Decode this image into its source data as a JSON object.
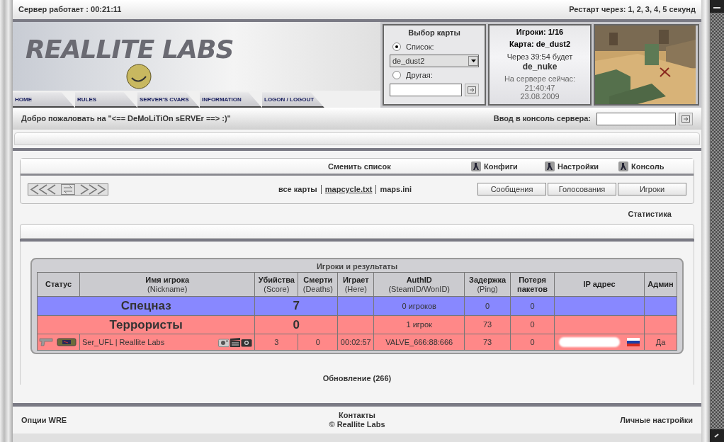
{
  "top_bar": {
    "uptime": "Сервер работает : 00:21:11",
    "restart": "Рестарт через: 1, 2, 3, 4, 5 секунд"
  },
  "logo": "REALLITE LABS",
  "nav": [
    "HOME",
    "RULES",
    "SERVER'S CVARS",
    "INFORMATION",
    "LOGON / LOGOUT"
  ],
  "map_select": {
    "title": "Выбор карты",
    "options": [
      {
        "label": "Список:",
        "selected": true,
        "kind": "select",
        "value": "de_dust2"
      },
      {
        "label": "Другая:",
        "selected": false,
        "kind": "input"
      }
    ]
  },
  "server_info": {
    "players": "Игроки: 1/16",
    "map": "Карта: de_dust2",
    "next_in": "Через 39:54 будет",
    "next_map": "de_nuke",
    "now_label": "На сервере сейчас:",
    "time": "21:40:47",
    "date": "23.08.2009"
  },
  "welcome": "Добро пожаловать на \"<== DeMoLiTiOn sERVEr ==> :)\"",
  "console": {
    "label": "Ввод в консоль сервера:"
  },
  "menu": {
    "title": "Сменить список",
    "links": [
      "Конфиги",
      "Настройки",
      "Консоль"
    ],
    "map_lists": [
      {
        "label": "все карты",
        "selected": false
      },
      {
        "label": "mapcycle.txt",
        "selected": true
      },
      {
        "label": "maps.ini",
        "selected": false
      }
    ],
    "buttons": [
      "Сообщения",
      "Голосования",
      "Игроки"
    ]
  },
  "stats_link": "Статистика",
  "players_table": {
    "title": "Игроки и результаты",
    "columns": [
      {
        "title": "Статус"
      },
      {
        "title": "Имя игрока",
        "subtitle": "(Nickname)"
      },
      {
        "title": "Убийства",
        "subtitle": "(Score)"
      },
      {
        "title": "Смерти",
        "subtitle": "(Deaths)"
      },
      {
        "title": "Играет",
        "subtitle": "(Here)"
      },
      {
        "title": "AuthID",
        "subtitle": "(SteamID/WonID)"
      },
      {
        "title": "Задержка",
        "subtitle": "(Ping)"
      },
      {
        "title": "Потеря пакетов"
      },
      {
        "title": "IP адрес"
      },
      {
        "title": "Админ"
      }
    ],
    "rows": [
      {
        "kind": "team",
        "color": "#8888ff",
        "name": "Спецназ",
        "score": "7",
        "players": "0 игроков",
        "ping": "0",
        "loss": "0"
      },
      {
        "kind": "team",
        "color": "#ff8888",
        "name": "Террористы",
        "score": "0",
        "players": "1 игрок",
        "ping": "73",
        "loss": "0"
      },
      {
        "kind": "player",
        "color": "#ff8888",
        "name": "Ser_UFL | Reallite Labs",
        "score": "3",
        "deaths": "0",
        "here": "00:02:57",
        "auth": "VALVE_666:88:666",
        "ping": "73",
        "loss": "0",
        "admin": "Да"
      }
    ]
  },
  "update": "Обновление (266)",
  "footer": {
    "left": "Опции WRE",
    "center": [
      "Контакты",
      "© Reallite Labs"
    ],
    "right": "Личные настройки"
  }
}
